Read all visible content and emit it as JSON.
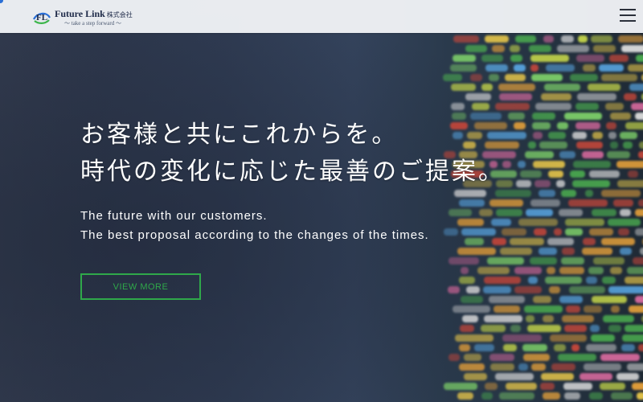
{
  "header": {
    "logo": {
      "name": "Future Link",
      "suffix": "株式会社",
      "tagline": "〜 take a step forward 〜",
      "mark_letters": "FL"
    },
    "menu_icon": "hamburger-menu-icon"
  },
  "hero": {
    "catch_lines": [
      "お客様と共にこれからを。",
      "時代の変化に応じた最善のご提案。"
    ],
    "sub_lines": [
      "The future with our customers.",
      "The best proposal according to the changes of the times."
    ],
    "cta_label": "VIEW MORE",
    "background_image": "blurred code on a monitor"
  },
  "colors": {
    "accent_green": "#2fa84a",
    "header_bg": "#f0f2f6",
    "logo_navy": "#1e2a48",
    "logo_blue": "#2a6fd6"
  }
}
